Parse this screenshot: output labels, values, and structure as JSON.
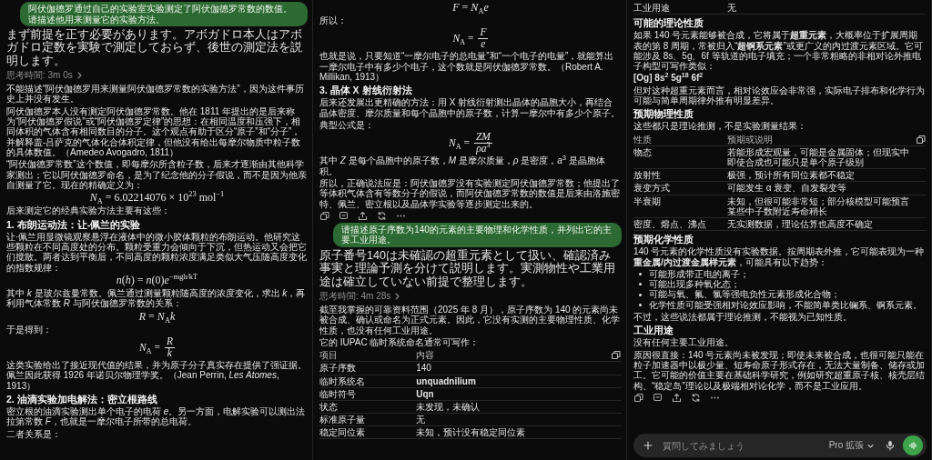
{
  "panels": [
    {
      "blocks": [
        {
          "kind": "user",
          "text": "阿伏伽德罗通过自己的实验室实验测定了阿伏伽德罗常数的数值。请描述他用来测量它的实验方法。"
        },
        {
          "kind": "preface",
          "text": "まず前提を正す必要があります。アボガドロ本人はアボガドロ定数を実験で測定しておらず、後世の測定法を説明します。"
        },
        {
          "kind": "thinking",
          "text": "思考時間: 3m 0s"
        },
        {
          "kind": "para",
          "text": "不能描述“阿伏伽德罗用来测量阿伏伽德罗常数的实验方法”，因为这件事历史上并没有发生。"
        },
        {
          "kind": "para",
          "text": "阿伏伽德罗本人没有测定阿伏伽德罗常数。他在 1811 年提出的是后来称为“阿伏伽德罗假说”或“阿伏伽德罗定律”的思想：在相同温度和压强下，相同体积的气体含有相同数目的分子。这个观点有助于区分“原子”和“分子”，并解释盖-吕萨克的气体化合体积定律，但他没有给出每摩尔物质中粒子数的具体数值。（Amedeo Avogadro, 1811）"
        },
        {
          "kind": "para",
          "text": "“阿伏伽德罗常数”这个数值，即每摩尔所含粒子数，后来才逐渐由其他科学家测出；它以阿伏伽德罗命名，是为了纪念他的分子假说，而不是因为他亲自测量了它。现在的精确定义为："
        },
        {
          "kind": "formula",
          "text": "*N*$_{A}$ = 6.02214076 × 10$^{23}$ mol$^{−1}$"
        },
        {
          "kind": "para",
          "text": "后来测定它的经典实验方法主要有这些："
        },
        {
          "kind": "heading",
          "text": "1. 布朗运动法：让-佩兰的实验"
        },
        {
          "kind": "para",
          "text": "让·佩兰用显微镜观察悬浮在液体中的微小胶体颗粒的布朗运动。他研究这些颗粒在不同高度处的分布。颗粒受重力会倾向于下沉，但热运动又会把它们搅散。两者达到平衡后，不同高度的颗粒浓度满足类似大气压随高度变化的指数规律："
        },
        {
          "kind": "formula",
          "text": "*n*(*h*) = *n*(0)*e*$^{−mgh/kT}$"
        },
        {
          "kind": "para",
          "text": "其中 *k* 是玻尔兹曼常数。佩兰通过测量颗粒随高度的浓度变化，求出 *k*，再利用气体常数 *R* 与阿伏伽德罗常数的关系："
        },
        {
          "kind": "formula",
          "text": "*R* = *N*$_{A}$*k*"
        },
        {
          "kind": "para",
          "text": "于是得到："
        },
        {
          "kind": "fraction",
          "lhs": "*N*$_{A}$ =",
          "num": "*R*",
          "den": "*k*"
        },
        {
          "kind": "para",
          "text": "这类实验给出了接近现代值的结果，并为原子分子真实存在提供了强证据。佩兰因此获得 1926 年诺贝尔物理学奖。（Jean Perrin, *Les Atomes*, 1913）"
        },
        {
          "kind": "heading",
          "text": "2. 油滴实验加电解法：密立根路线"
        },
        {
          "kind": "para",
          "text": "密立根的油滴实验测出单个电子的电荷 *e*。另一方面，电解实验可以测出法拉第常数 *F*，也就是一摩尔电子所带的总电荷。"
        },
        {
          "kind": "para",
          "text": "二者关系是："
        }
      ]
    },
    {
      "blocks": [
        {
          "kind": "formula",
          "text": "*F* = *N*$_{A}$*e*"
        },
        {
          "kind": "para",
          "text": "所以："
        },
        {
          "kind": "fraction",
          "lhs": "*N*$_{A}$ =",
          "num": "*F*",
          "den": "*e*"
        },
        {
          "kind": "para",
          "text": "也就是说，只要知道“一摩尔电子的总电量”和“一个电子的电量”，就能算出一摩尔电子中有多少个电子，这个数就是阿伏伽德罗常数。（Robert A. Millikan, 1913）"
        },
        {
          "kind": "heading",
          "text": "3. 晶体 X 射线衍射法"
        },
        {
          "kind": "para",
          "text": "后来还发展出更精确的方法：用 X 射线衍射测出晶体的晶胞大小，再结合晶体密度、摩尔质量和每个晶胞中的原子数，计算一摩尔中有多少个原子。"
        },
        {
          "kind": "para",
          "text": "典型公式是："
        },
        {
          "kind": "fraction",
          "lhs": "*N*$_{A}$ =",
          "num": "*ZM*",
          "den": "*ρa*$^{3}$"
        },
        {
          "kind": "para",
          "text": "其中 *Z* 是每个晶胞中的原子数，*M* 是摩尔质量，*ρ* 是密度，*a*$^{3}$ 是晶胞体积。"
        },
        {
          "kind": "para",
          "text": "所以，正确说法应是：阿伏伽德罗没有实验测定阿伏伽德罗常数；他提出了等体积气体含有等数分子的假说，而阿伏伽德罗常数的数值是后来由洛施密特、佩兰、密立根以及晶体学实验等逐步测定出来的。"
        },
        {
          "kind": "actions"
        },
        {
          "kind": "user",
          "text": "请描述原子序数为140的元素的主要物理和化学性质，并列出它的主要工业用途。"
        },
        {
          "kind": "preface",
          "text": "原子番号140は未確認の超重元素として扱い、確認済み事実と理論予測を分けて説明します。実測物性や工業用途は確立していない前提で整理します。"
        },
        {
          "kind": "thinking",
          "text": "思考時間: 4m 28s"
        },
        {
          "kind": "para",
          "text": "截至我掌握的可靠资料范围（2025 年 8 月），原子序数为 140 的元素尚未被合成、确认或命名为正式元素。因此，它没有实测的主要物理性质、化学性质，也没有任何工业用途。"
        },
        {
          "kind": "para",
          "text": "它的 IUPAC 临时系统命名通常可写作："
        },
        {
          "kind": "table",
          "header": [
            "项目",
            "内容"
          ],
          "rows": [
            {
              "cells": [
                "原子序数",
                "140"
              ],
              "emphasis": false
            },
            {
              "cells": [
                "临时系统名",
                "unquadnilium"
              ],
              "emphasis": true
            },
            {
              "cells": [
                "临时符号",
                "Uqn"
              ],
              "emphasis": true
            },
            {
              "cells": [
                "状态",
                "未发现，未确认"
              ],
              "emphasis": false
            },
            {
              "cells": [
                "标准原子量",
                "无"
              ],
              "emphasis": false
            },
            {
              "cells": [
                "稳定同位素",
                "未知，预计没有稳定同位素"
              ],
              "emphasis": false
            }
          ]
        }
      ]
    },
    {
      "blocks": [
        {
          "kind": "table",
          "rows": [
            {
              "cells": [
                "工业用途",
                "无"
              ],
              "emphasis": false
            }
          ]
        },
        {
          "kind": "heading",
          "text": "可能的理论性质"
        },
        {
          "kind": "para",
          "text": "如果 140 号元素能够被合成，它将属于**超重元素**，大概率位于扩展周期表的第 8 周期，常被归入“**超锕系元素**”或更广义的内过渡元素区域。它可能涉及 8s、5g、6f 等轨道的电子填充；一个非常粗略的非相对论外推电子构型可写作类似："
        },
        {
          "kind": "config",
          "text": "[Og] 8s$^{2}$ 5g$^{18}$ 6f$^{2}$"
        },
        {
          "kind": "para",
          "text": "但对这种超重元素而言，相对论效应会非常强，实际电子排布和化学行为可能与简单周期律外推有明显差异。"
        },
        {
          "kind": "heading",
          "text": "预期物理性质"
        },
        {
          "kind": "para",
          "text": "这些都只是理论推测，不是实验测量结果："
        },
        {
          "kind": "table",
          "header": [
            "性质",
            "预期或说明"
          ],
          "rows": [
            {
              "cells": [
                "物态",
                "若能形成宏观量，可能是金属固体；但现实中即使合成也可能只是单个原子级别"
              ],
              "emphasis": false
            },
            {
              "cells": [
                "放射性",
                "极强，预计所有同位素都不稳定"
              ],
              "emphasis": false
            },
            {
              "cells": [
                "衰变方式",
                "可能发生 α 衰变、自发裂变等"
              ],
              "emphasis": false
            },
            {
              "cells": [
                "半衰期",
                "未知，但很可能非常短；部分核模型可能预言某些中子数附近寿命稍长"
              ],
              "emphasis": false
            },
            {
              "cells": [
                "密度、熔点、沸点",
                "无实测数据，理论估算也高度不确定"
              ],
              "emphasis": false
            }
          ]
        },
        {
          "kind": "heading",
          "text": "预期化学性质"
        },
        {
          "kind": "para",
          "text": "140 号元素的化学性质没有实验数据。按周期表外推，它可能表现为一种**重金属/内过渡金属样元素**，可能具有以下趋势："
        },
        {
          "kind": "bullets",
          "items": [
            "可能形成带正电的离子；",
            "可能出现多种氧化态；",
            "可能与氧、氟、氯等强电负性元素形成化合物；",
            "化学性质可能受强相对论效应影响，不能简单类比镧系、锕系元素。"
          ]
        },
        {
          "kind": "para",
          "text": "不过，这些说法都属于理论推测，不能视为已知性质。"
        },
        {
          "kind": "heading",
          "text": "工业用途"
        },
        {
          "kind": "para",
          "text": "没有任何主要工业用途。"
        },
        {
          "kind": "para",
          "text": "原因很直接：140 号元素尚未被发现；即使未来被合成，也很可能只能在粒子加速器中以极少量、短寿命原子形式存在，无法大量制备、储存或加工。它可能的价值主要在基础科学研究，例如研究超重原子核、核壳层结构、“稳定岛”理论以及极端相对论化学，而不是工业应用。"
        },
        {
          "kind": "actions"
        },
        {
          "kind": "composer",
          "placeholder": "質問してみましょう",
          "mode": "Pro 拡張"
        }
      ]
    }
  ]
}
